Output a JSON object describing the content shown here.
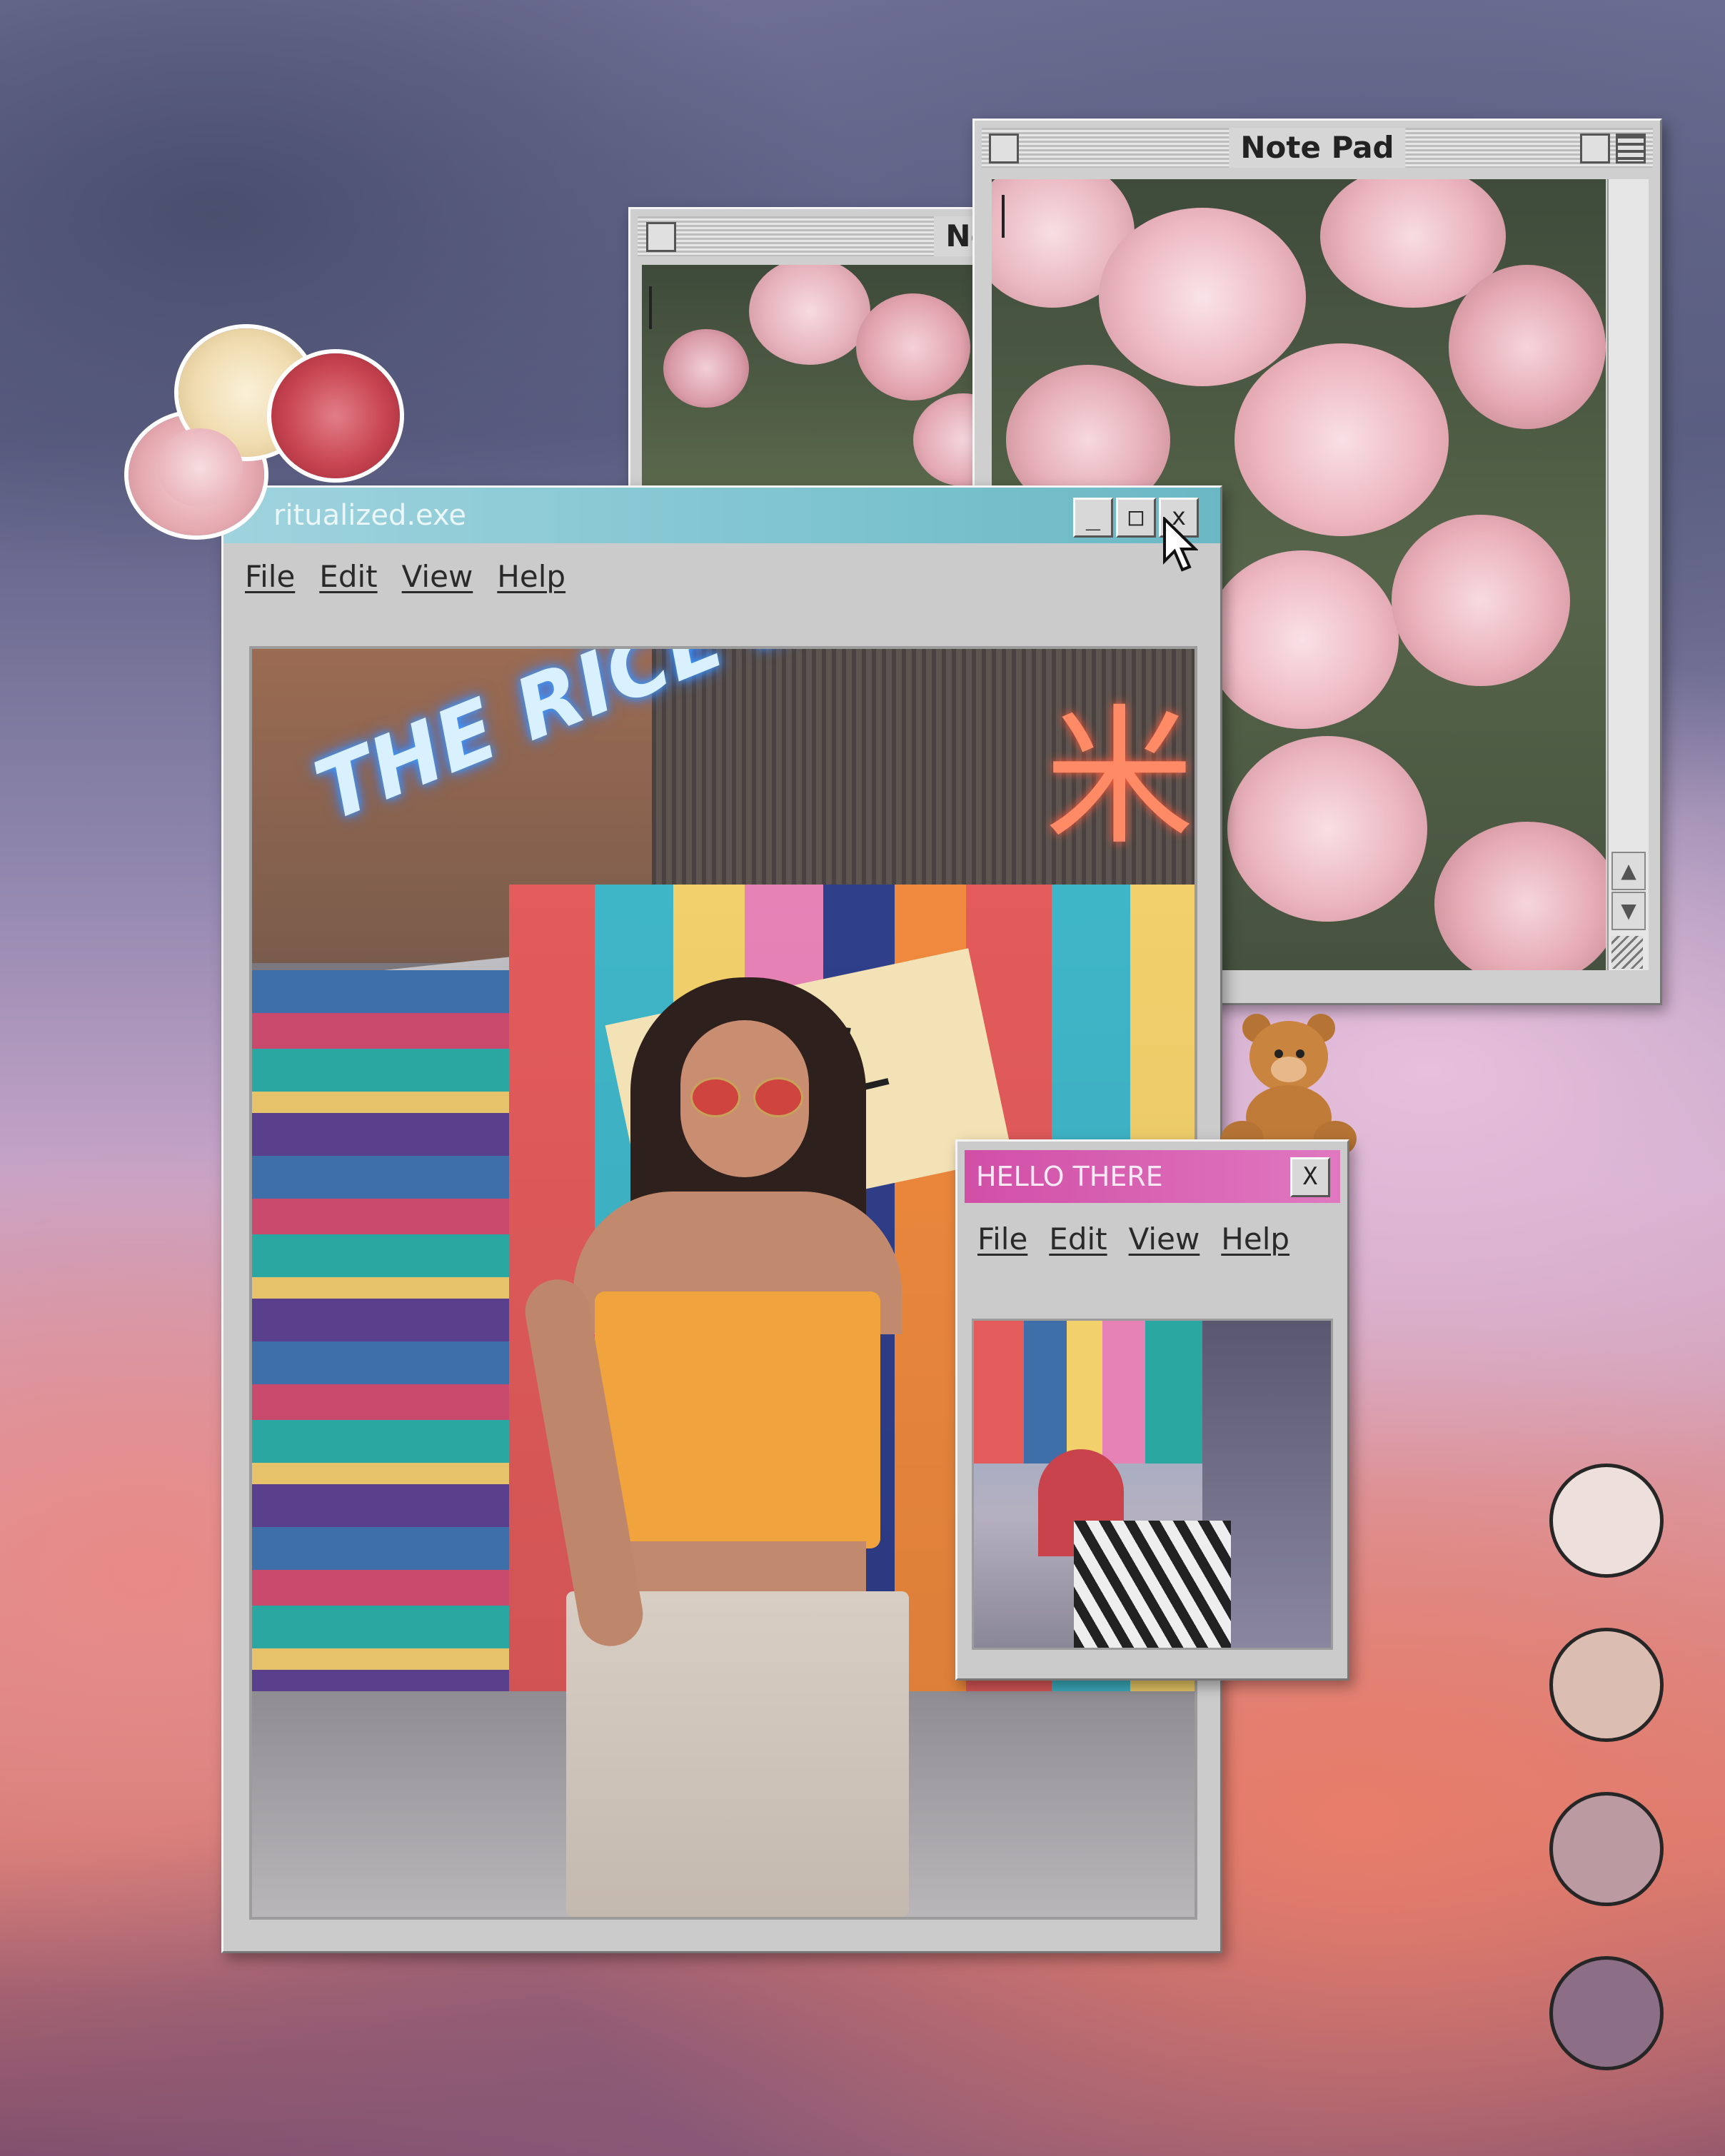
{
  "notepad_back": {
    "title": "Note"
  },
  "notepad_front": {
    "title": "Note Pad"
  },
  "main_window": {
    "title": "ritualized.exe",
    "minimize": "_",
    "maximize": "□",
    "close": "x",
    "menu": [
      "File",
      "Edit",
      "View",
      "Help"
    ],
    "photo": {
      "sign_neon": "THE RICE BO",
      "kanji": "米"
    }
  },
  "hello_window": {
    "title": "HELLO THERE",
    "close": "X",
    "menu": [
      "File",
      "Edit",
      "View",
      "Help"
    ]
  },
  "palette": [
    "#ede0dc",
    "#dcbdb2",
    "#bb9aa2",
    "#8c6f86"
  ],
  "icons": {
    "teddy": "teddy-bear-icon",
    "cursor": "mouse-pointer-icon"
  }
}
